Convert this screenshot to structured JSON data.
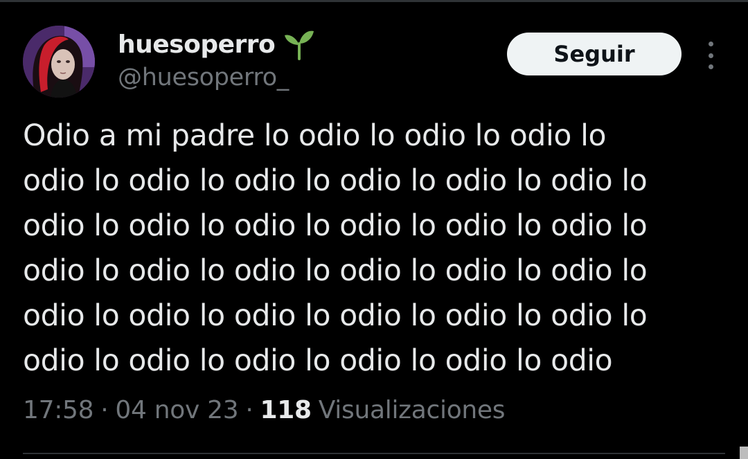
{
  "author": {
    "display_name": "huesoperro",
    "handle": "@huesoperro_",
    "name_emoji": "sprout-icon"
  },
  "follow_button": {
    "label": "Seguir"
  },
  "more_menu": {
    "icon": "more-vertical-icon"
  },
  "tweet": {
    "lines": [
      "Odio a mi padre lo odio lo odio lo odio lo",
      "odio lo odio lo odio lo odio lo odio lo odio lo",
      "odio lo odio lo odio lo odio lo odio lo odio lo",
      "odio lo odio lo odio lo odio lo odio lo odio lo",
      "odio lo odio lo odio lo odio lo odio lo odio lo",
      "odio lo odio lo odio lo odio lo odio lo odio"
    ]
  },
  "meta": {
    "time": "17:58",
    "separator": "·",
    "date": "04 nov 23",
    "views_count": "118",
    "views_label": "Visualizaciones"
  },
  "colors": {
    "background": "#000000",
    "primary_text": "#e7e9ea",
    "secondary_text": "#71767b",
    "button_bg": "#eff3f4",
    "button_text": "#0f1419",
    "divider": "#2f3336",
    "sprout_green": "#77b255"
  }
}
